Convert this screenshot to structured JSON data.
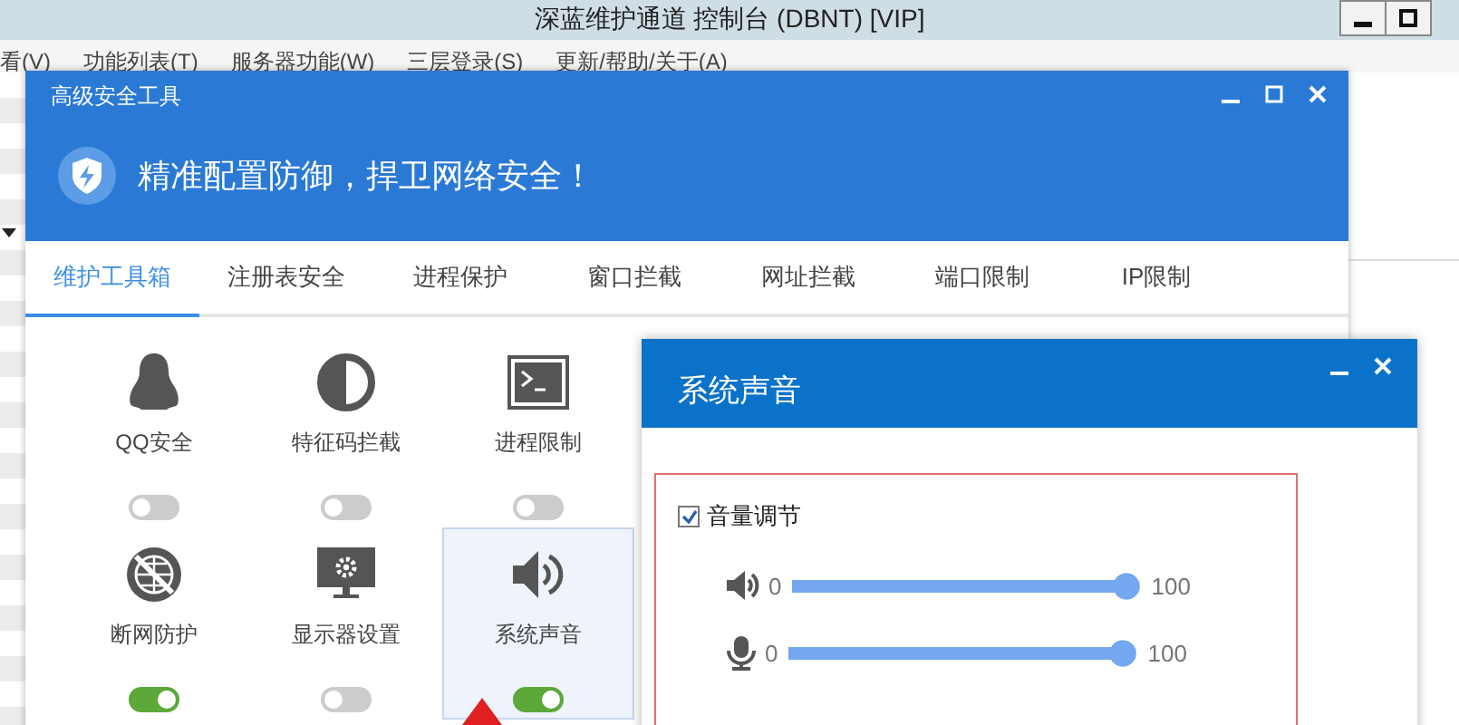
{
  "main_window": {
    "title": "深蓝维护通道 控制台 (DBNT) [VIP]",
    "menu": [
      "看(V)",
      "功能列表(T)",
      "服务器功能(W)",
      "三层登录(S)",
      "更新/帮助/关于(A)"
    ]
  },
  "tool_window": {
    "title": "高级安全工具",
    "banner": "精准配置防御，捍卫网络安全！",
    "tabs": [
      {
        "label": "维护工具箱",
        "selected": true
      },
      {
        "label": "注册表安全",
        "selected": false
      },
      {
        "label": "进程保护",
        "selected": false
      },
      {
        "label": "窗口拦截",
        "selected": false
      },
      {
        "label": "网址拦截",
        "selected": false
      },
      {
        "label": "端口限制",
        "selected": false
      },
      {
        "label": "IP限制",
        "selected": false
      }
    ],
    "tools": [
      {
        "label": "QQ安全",
        "on": false,
        "selected": false
      },
      {
        "label": "特征码拦截",
        "on": false,
        "selected": false
      },
      {
        "label": "进程限制",
        "on": false,
        "selected": false
      },
      {
        "label": "断网防护",
        "on": true,
        "selected": false
      },
      {
        "label": "显示器设置",
        "on": false,
        "selected": false
      },
      {
        "label": "系统声音",
        "on": true,
        "selected": true
      }
    ]
  },
  "sound_dialog": {
    "title": "系统声音",
    "volume_control": {
      "label": "音量调节",
      "checked": true
    },
    "sliders": [
      {
        "kind": "speaker",
        "min": "0",
        "max": "100",
        "level": 1
      },
      {
        "kind": "microphone",
        "min": "0",
        "max": "100",
        "level": 1
      }
    ]
  }
}
